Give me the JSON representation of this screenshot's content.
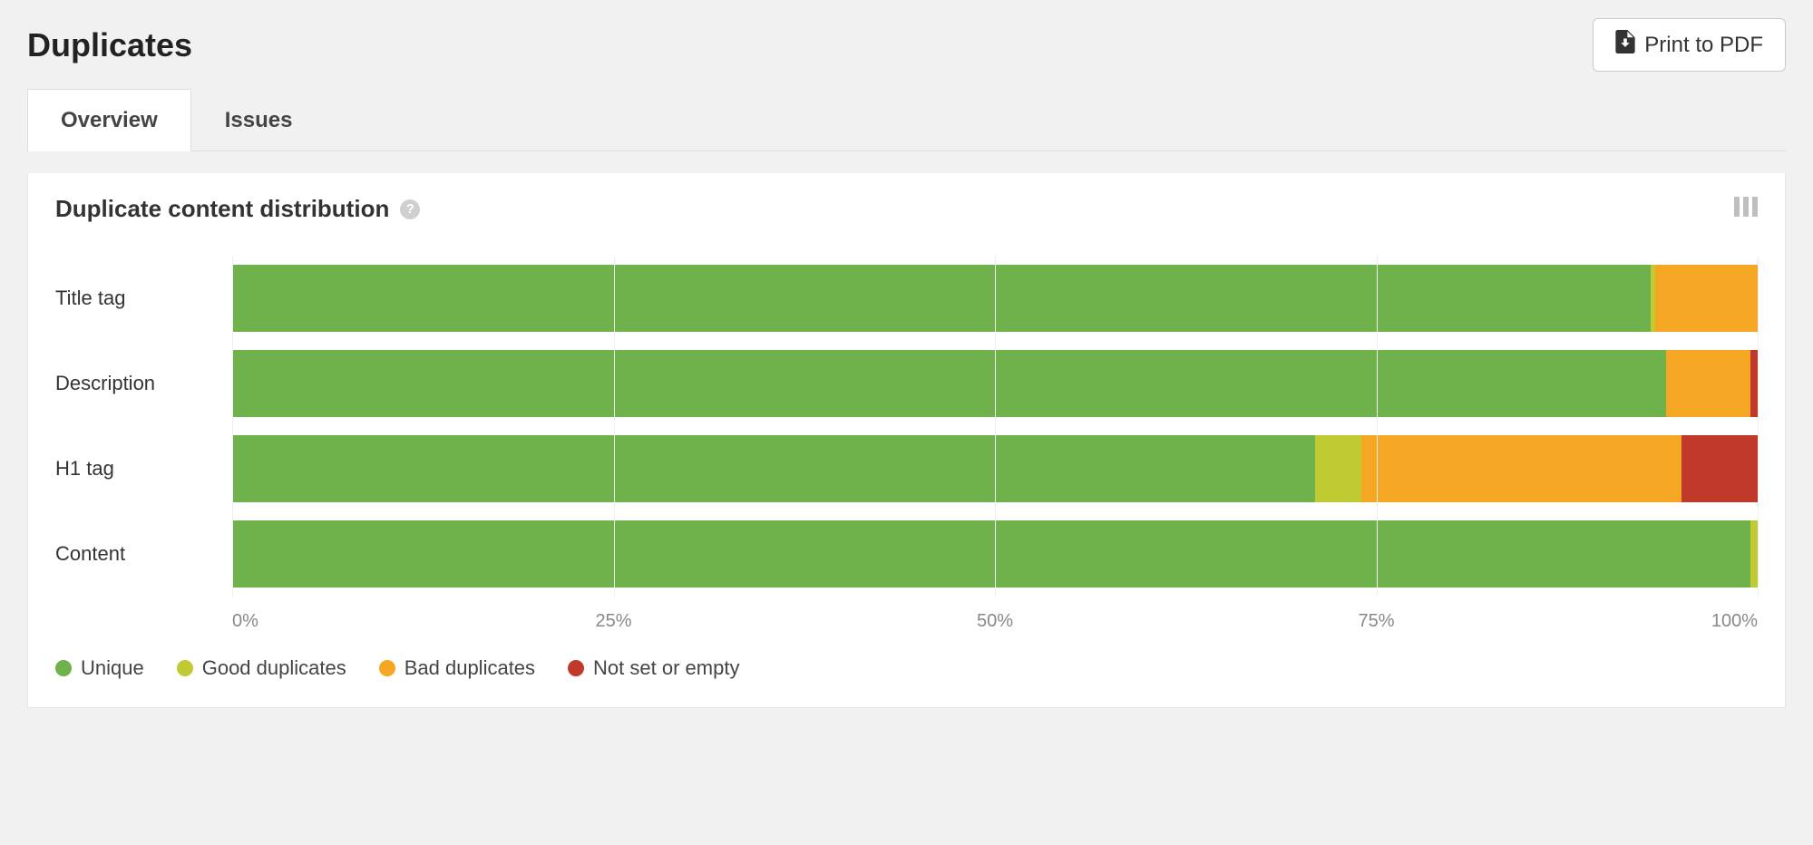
{
  "header": {
    "title": "Duplicates",
    "print_label": "Print to PDF"
  },
  "tabs": [
    {
      "label": "Overview",
      "active": true
    },
    {
      "label": "Issues",
      "active": false
    }
  ],
  "card": {
    "title": "Duplicate content distribution"
  },
  "chart_data": {
    "type": "bar",
    "stacked": true,
    "orientation": "horizontal",
    "xlabel": "",
    "ylabel": "",
    "xlim": [
      0,
      100
    ],
    "ticks": [
      "0%",
      "25%",
      "50%",
      "75%",
      "100%"
    ],
    "categories": [
      "Title tag",
      "Description",
      "H1 tag",
      "Content"
    ],
    "series": [
      {
        "name": "Unique",
        "key": "unique",
        "color": "#6fb24c",
        "values": [
          93.0,
          94.0,
          71.0,
          99.5
        ]
      },
      {
        "name": "Good duplicates",
        "key": "good",
        "color": "#c0ca33",
        "values": [
          0.3,
          0.0,
          3.0,
          0.5
        ]
      },
      {
        "name": "Bad duplicates",
        "key": "bad",
        "color": "#f5a623",
        "values": [
          6.7,
          5.5,
          21.0,
          0.0
        ]
      },
      {
        "name": "Not set or empty",
        "key": "empty",
        "color": "#c0392b",
        "values": [
          0.0,
          0.5,
          5.0,
          0.0
        ]
      }
    ],
    "legend": [
      "Unique",
      "Good duplicates",
      "Bad duplicates",
      "Not set or empty"
    ]
  }
}
